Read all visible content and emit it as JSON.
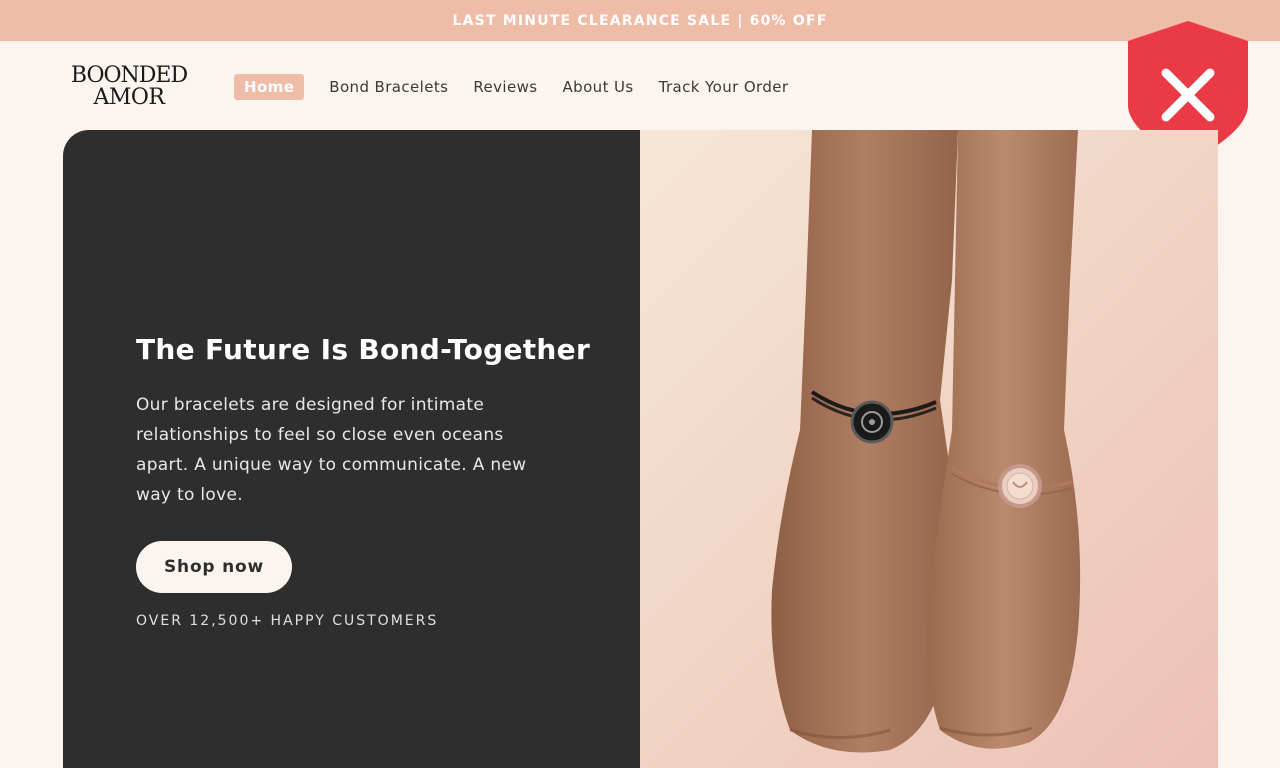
{
  "announcement": {
    "text": "LAST MINUTE CLEARANCE SALE | 60% OFF"
  },
  "logo": {
    "line1": "BOONDED",
    "line2": "AMOR"
  },
  "nav": {
    "items": [
      {
        "label": "Home",
        "active": true
      },
      {
        "label": "Bond Bracelets",
        "active": false
      },
      {
        "label": "Reviews",
        "active": false
      },
      {
        "label": "About Us",
        "active": false
      },
      {
        "label": "Track Your Order",
        "active": false
      }
    ]
  },
  "overlay": {
    "icon": "shield-close-icon",
    "color": "#e93a45"
  },
  "hero": {
    "title": "The Future Is Bond-Together",
    "description": "Our bracelets are designed for intimate relationships to feel so close even oceans apart. A unique way to communicate. A new way to love.",
    "button_label": "Shop now",
    "customers_text": "OVER 12,500+ HAPPY CUSTOMERS",
    "image": "hands-with-bracelets-photo"
  },
  "colors": {
    "accent": "#efbca8",
    "background": "#fcf5ef",
    "panel": "#2e2e2e"
  }
}
